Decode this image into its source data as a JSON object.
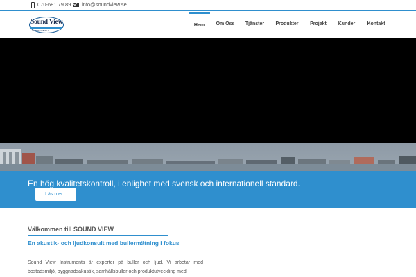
{
  "topbar": {
    "phone": "070-681 79 89",
    "email": "info@soundview.se"
  },
  "logo": {
    "name": "Sound View",
    "sub": "INSTRUMENTS"
  },
  "nav": {
    "items": [
      {
        "label": "Hem",
        "active": true
      },
      {
        "label": "Om Oss"
      },
      {
        "label": "Tjänster"
      },
      {
        "label": "Produkter"
      },
      {
        "label": "Projekt"
      },
      {
        "label": "Kunder"
      },
      {
        "label": "Kontakt"
      }
    ]
  },
  "banner": {
    "tagline": "En hög kvalitetskontroll, i enlighet med svensk och internationell standard.",
    "button": "Läs mer..."
  },
  "content": {
    "welcome": "Välkommen till SOUND VIEW",
    "subhead": "En akustik- och ljudkonsult med bullermätning i fokus",
    "body": "Sound View Instruments är experter på buller och ljud. Vi arbetar med bostadsmiljö, byggnadsakustik, samhällsbuller och produktutveckling med"
  },
  "colors": {
    "accent": "#2f8fce",
    "hero": "#000000"
  }
}
